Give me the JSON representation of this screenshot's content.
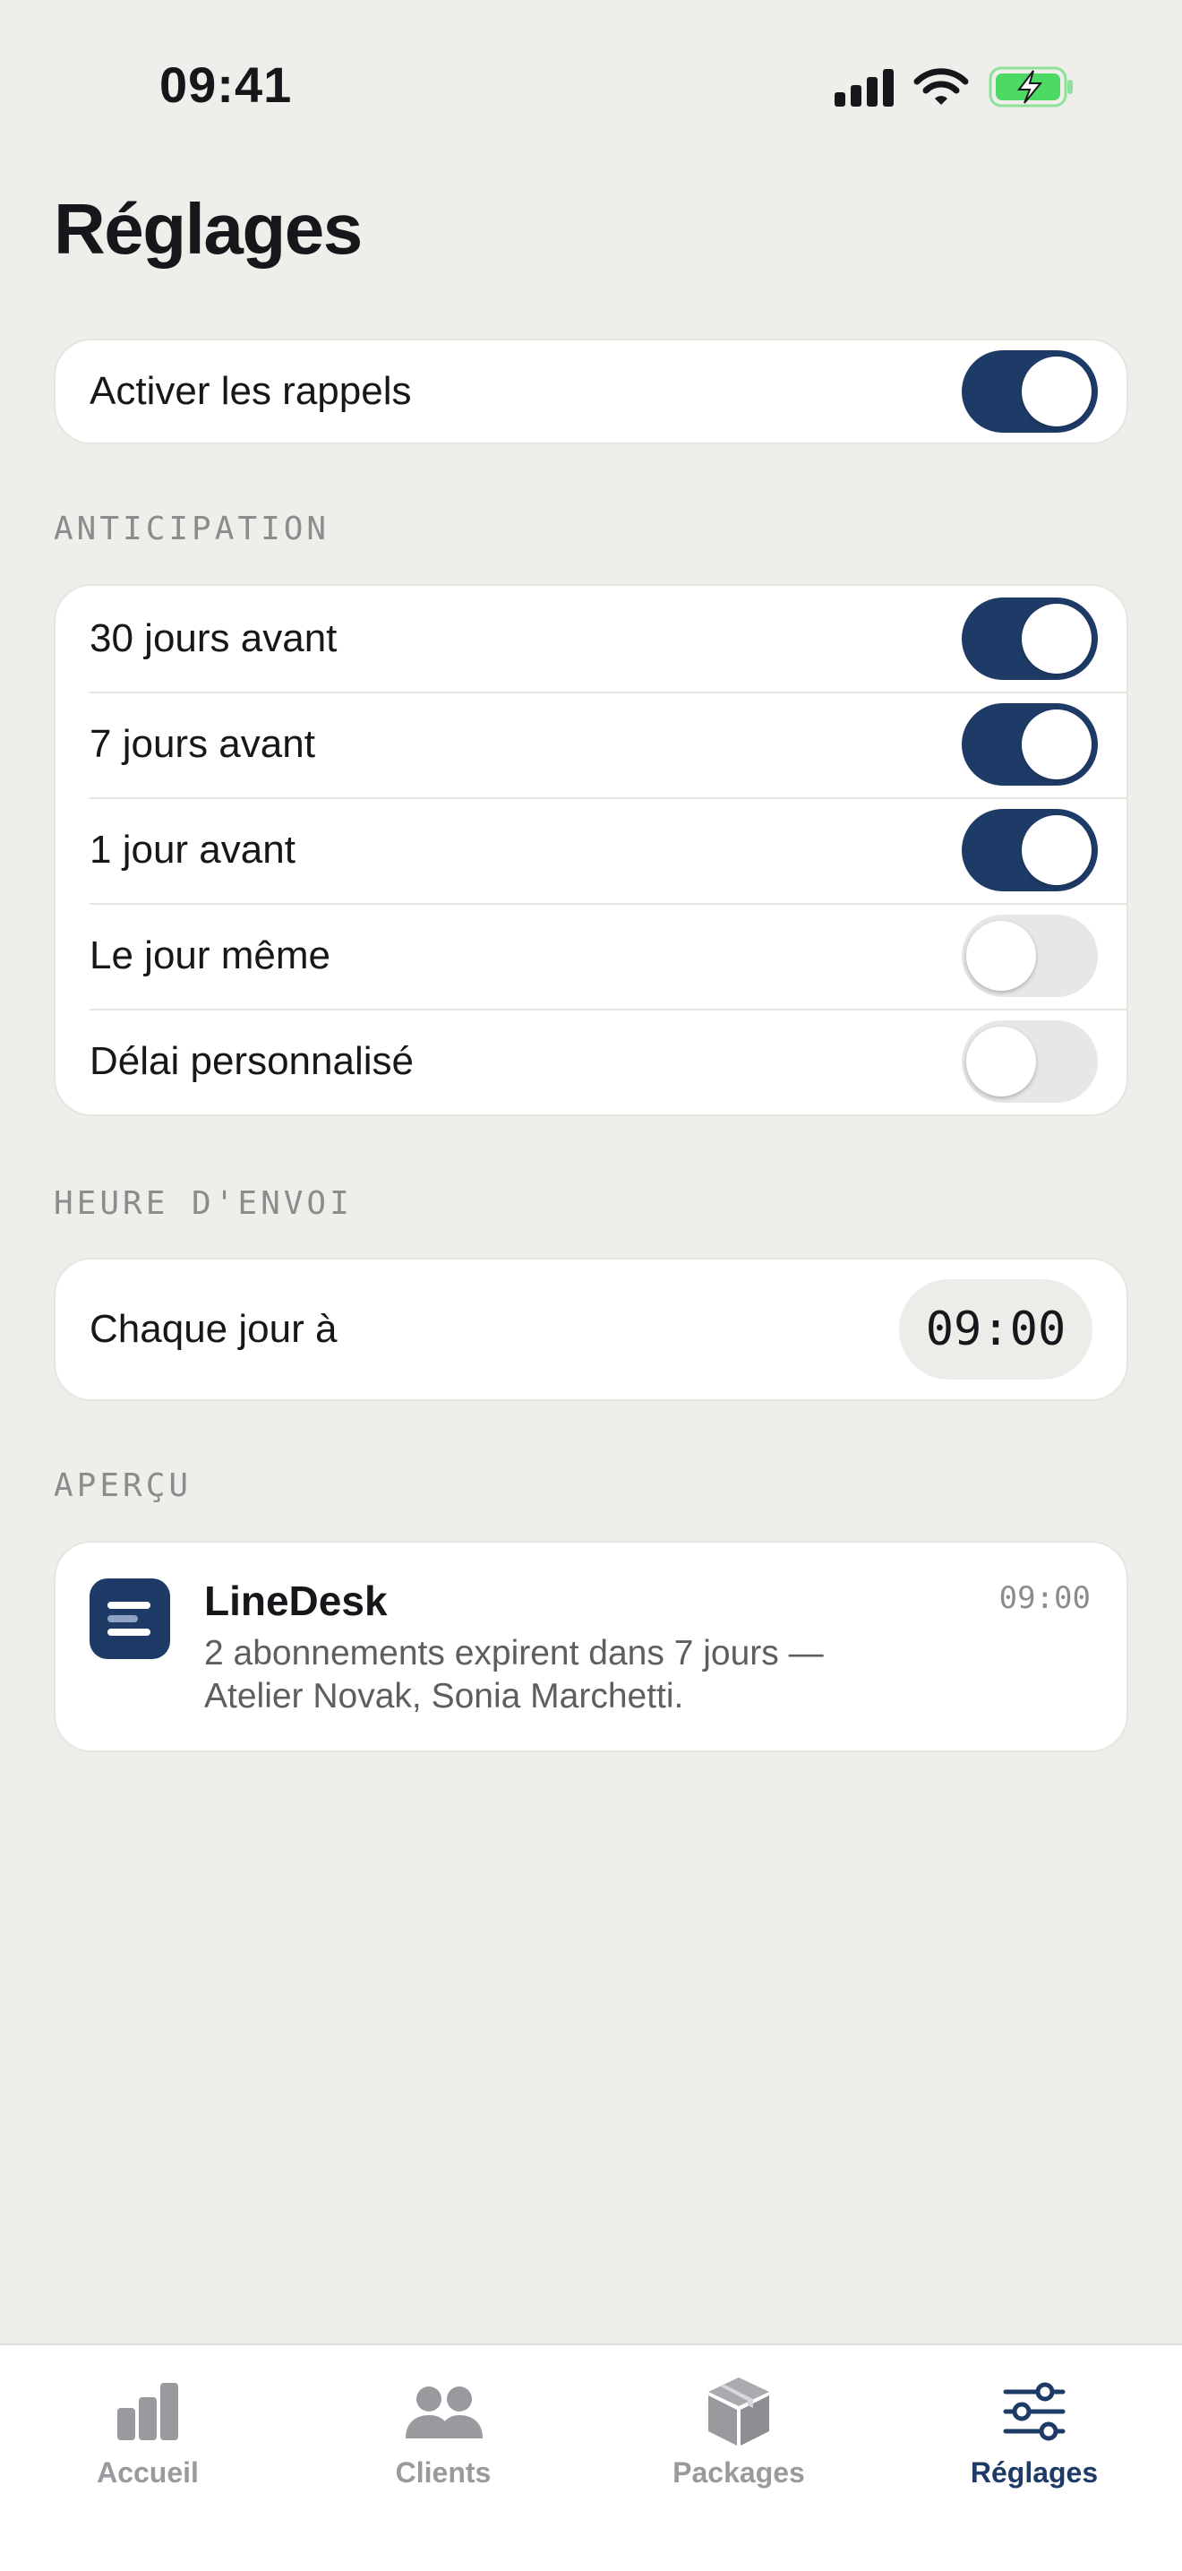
{
  "status_bar": {
    "time": "09:41"
  },
  "colors": {
    "accent": "#1E3A66",
    "background": "#EFEEEA",
    "battery": "#4CD964",
    "muted_text": "#8C8C8C"
  },
  "page": {
    "title": "Réglages"
  },
  "main_toggle": {
    "label": "Activer les rappels",
    "enabled": true
  },
  "anticipation": {
    "header": "ANTICIPATION",
    "items": [
      {
        "label": "30 jours avant",
        "enabled": true
      },
      {
        "label": "7 jours avant",
        "enabled": true
      },
      {
        "label": "1 jour avant",
        "enabled": true
      },
      {
        "label": "Le jour même",
        "enabled": false
      },
      {
        "label": "Délai personnalisé",
        "enabled": false
      }
    ]
  },
  "send_time": {
    "header": "HEURE D'ENVOI",
    "label": "Chaque jour à",
    "value": "09:00"
  },
  "preview": {
    "header": "APERÇU",
    "app_name": "LineDesk",
    "time": "09:00",
    "message": "2 abonnements expirent dans 7 jours — Atelier Novak, Sonia Marchetti."
  },
  "tab_bar": {
    "tabs": [
      {
        "label": "Accueil",
        "icon": "chart-bar-icon",
        "active": false
      },
      {
        "label": "Clients",
        "icon": "people-icon",
        "active": false
      },
      {
        "label": "Packages",
        "icon": "box-icon",
        "active": false
      },
      {
        "label": "Réglages",
        "icon": "sliders-icon",
        "active": true
      }
    ]
  }
}
